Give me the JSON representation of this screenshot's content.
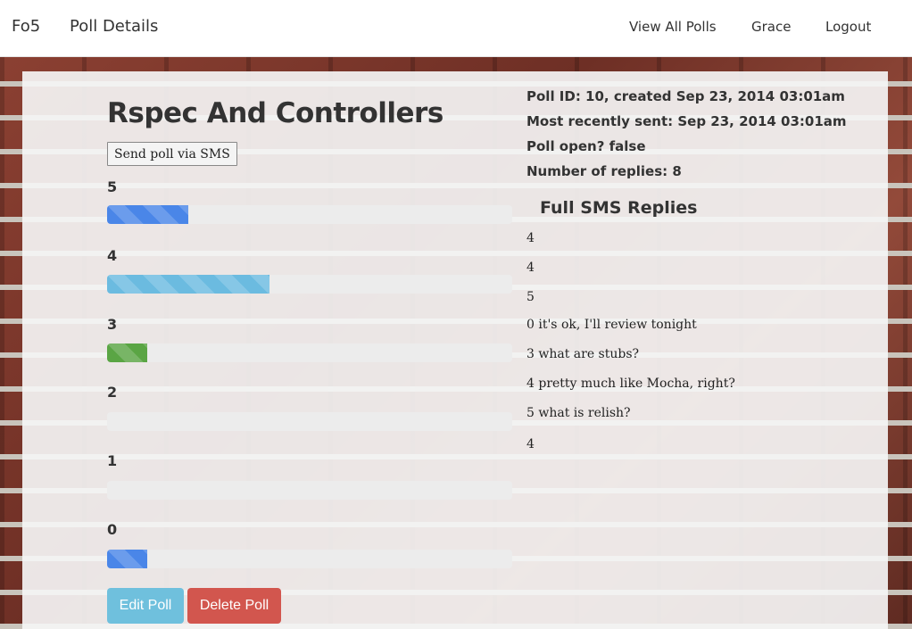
{
  "navbar": {
    "brand": "Fo5",
    "page_title": "Poll Details",
    "view_all_polls": "View All Polls",
    "user_name": "Grace",
    "logout": "Logout"
  },
  "poll": {
    "title": "Rspec And Controllers",
    "send_sms_label": "Send poll via SMS",
    "options": [
      {
        "label": "5",
        "fraction": 0.2,
        "color": "#4a86e8"
      },
      {
        "label": "4",
        "fraction": 0.4,
        "color": "#6bbbe0"
      },
      {
        "label": "3",
        "fraction": 0.1,
        "color": "#5aa544"
      },
      {
        "label": "2",
        "fraction": 0.0,
        "color": "#4a86e8"
      },
      {
        "label": "1",
        "fraction": 0.0,
        "color": "#4a86e8"
      },
      {
        "label": "0",
        "fraction": 0.1,
        "color": "#4a86e8"
      }
    ],
    "edit_label": "Edit Poll",
    "delete_label": "Delete Poll"
  },
  "info": {
    "poll_id": "Poll ID: 10, created Sep 23, 2014 03:01am",
    "recently_sent": "Most recently sent: Sep 23, 2014 03:01am",
    "poll_open": "Poll open? false",
    "num_replies": "Number of replies: 8"
  },
  "replies": {
    "heading": "Full SMS Replies",
    "items": [
      "4",
      "4",
      "5",
      "0 it's ok, I'll review tonight",
      "3 what are stubs?",
      "4 pretty much like Mocha, right?",
      "5 what is relish?",
      "4"
    ]
  }
}
